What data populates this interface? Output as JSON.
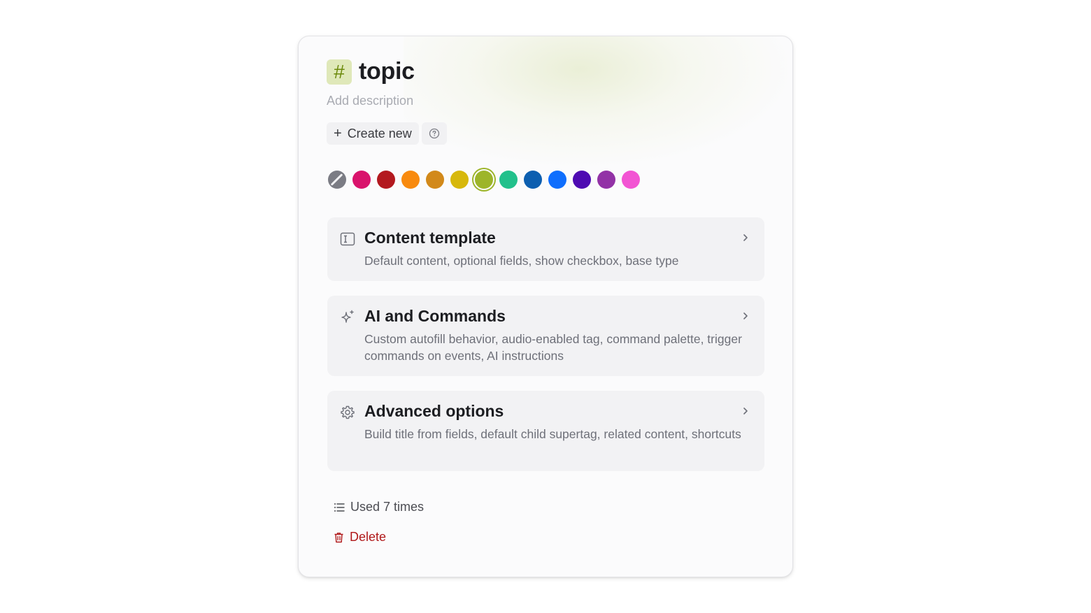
{
  "tag": {
    "symbol": "#",
    "name": "topic",
    "description_placeholder": "Add description",
    "accent_color": "#9db52a"
  },
  "actions": {
    "create_new_label": "Create new",
    "help_icon": "question-circle-icon"
  },
  "color_swatches": [
    {
      "name": "none",
      "color": "#7b7c84"
    },
    {
      "name": "pink",
      "color": "#d9136c"
    },
    {
      "name": "red",
      "color": "#b3191f"
    },
    {
      "name": "orange",
      "color": "#f88a0e"
    },
    {
      "name": "amber",
      "color": "#d2891a"
    },
    {
      "name": "yellow",
      "color": "#d7b80c"
    },
    {
      "name": "lime",
      "color": "#9db52a",
      "selected": true
    },
    {
      "name": "green",
      "color": "#22c08b"
    },
    {
      "name": "navy",
      "color": "#0d5fb0"
    },
    {
      "name": "blue",
      "color": "#0f6efd"
    },
    {
      "name": "indigo",
      "color": "#4e0bb2"
    },
    {
      "name": "purple",
      "color": "#9232a6"
    },
    {
      "name": "magenta",
      "color": "#f254d3"
    }
  ],
  "sections": [
    {
      "icon": "text-cursor-box-icon",
      "title": "Content template",
      "description": "Default content, optional fields, show checkbox, base type"
    },
    {
      "icon": "sparkles-icon",
      "title": "AI and Commands",
      "description": "Custom autofill behavior, audio-enabled tag, command palette, trigger commands on events, AI instructions"
    },
    {
      "icon": "gear-icon",
      "title": "Advanced options",
      "description": "Build title from fields, default child supertag, related content, shortcuts"
    }
  ],
  "footer": {
    "usage_label": "Used 7 times",
    "delete_label": "Delete"
  }
}
